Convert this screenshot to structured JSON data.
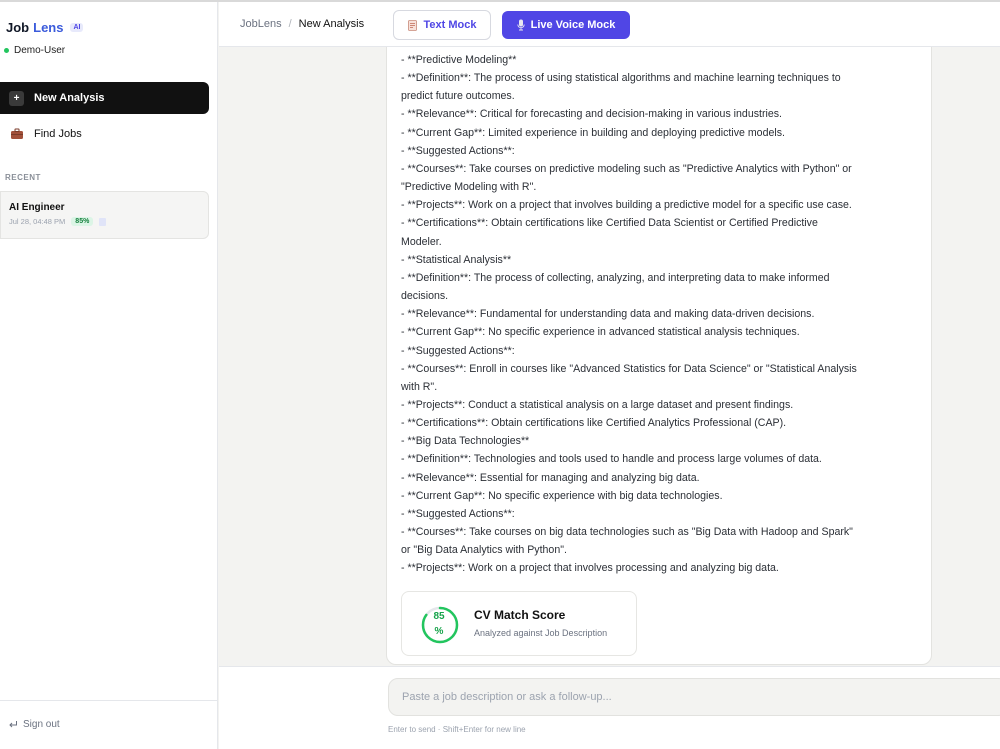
{
  "app": {
    "brand_part1": "Job",
    "brand_part2": "Lens",
    "badge": "AI",
    "user": "Demo-User"
  },
  "sidebar": {
    "new_analysis": "New Analysis",
    "find_jobs": "Find Jobs",
    "recent_label": "RECENT",
    "recent": [
      {
        "title": "AI Engineer",
        "date": "Jul 28, 04:48 PM",
        "score": "85%"
      }
    ],
    "sign_out": "Sign out"
  },
  "header": {
    "breadcrumb_root": "JobLens",
    "breadcrumb_sep": "/",
    "breadcrumb_current": "New Analysis",
    "text_mock": "Text Mock",
    "voice_mock": "Live Voice Mock"
  },
  "message_lines": [
    "  - **Predictive Modeling**",
    "    - **Definition**: The process of using statistical algorithms and machine learning techniques to",
    "predict future outcomes.",
    "    - **Relevance**: Critical for forecasting and decision-making in various industries.",
    "    - **Current Gap**: Limited experience in building and deploying predictive models.",
    "    - **Suggested Actions**:",
    "      - **Courses**: Take courses on predictive modeling such as \"Predictive Analytics with Python\" or",
    "\"Predictive Modeling with R\".",
    "      - **Projects**: Work on a project that involves building a predictive model for a specific use case.",
    "      - **Certifications**: Obtain certifications like Certified Data Scientist or Certified Predictive",
    "Modeler.",
    "  - **Statistical Analysis**",
    "    - **Definition**: The process of collecting, analyzing, and interpreting data to make informed",
    "decisions.",
    "    - **Relevance**: Fundamental for understanding data and making data-driven decisions.",
    "    - **Current Gap**: No specific experience in advanced statistical analysis techniques.",
    "    - **Suggested Actions**:",
    "      - **Courses**: Enroll in courses like \"Advanced Statistics for Data Science\" or \"Statistical Analysis",
    "with R\".",
    "      - **Projects**: Conduct a statistical analysis on a large dataset and present findings.",
    "      - **Certifications**: Obtain certifications like Certified Analytics Professional (CAP).",
    "  - **Big Data Technologies**",
    "    - **Definition**: Technologies and tools used to handle and process large volumes of data.",
    "    - **Relevance**: Essential for managing and analyzing big data.",
    "    - **Current Gap**: No specific experience with big data technologies.",
    "    - **Suggested Actions**:",
    "      - **Courses**: Take courses on big data technologies such as \"Big Data with Hadoop and Spark\"",
    "or \"Big Data Analytics with Python\".",
    "      - **Projects**: Work on a project that involves processing and analyzing big data."
  ],
  "score": {
    "value": 85,
    "display_line1": "85",
    "display_line2": "%",
    "title": "CV Match Score",
    "subtitle": "Analyzed against Job Description",
    "ring_color": "#22c55e"
  },
  "composer": {
    "placeholder": "Paste a job description or ask a follow-up...",
    "hint": "Enter to send · Shift+Enter for new line"
  },
  "colors": {
    "accent": "#5046e5",
    "brand_blue": "#3b5bdb",
    "success": "#22c55e"
  }
}
